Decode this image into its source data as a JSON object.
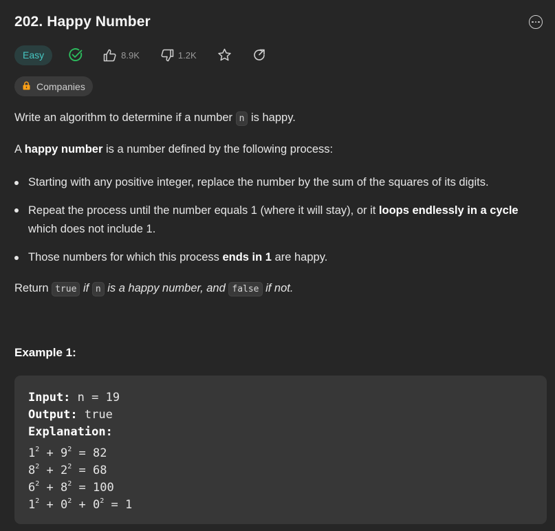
{
  "problem": {
    "title": "202. Happy Number",
    "difficulty": "Easy",
    "likes": "8.9K",
    "dislikes": "1.2K",
    "companies_label": "Companies"
  },
  "description": {
    "p1_a": "Write an algorithm to determine if a number ",
    "p1_code": "n",
    "p1_b": " is happy.",
    "p2_a": "A ",
    "p2_bold": "happy number",
    "p2_b": " is a number defined by the following process:",
    "bullet1": "Starting with any positive integer, replace the number by the sum of the squares of its digits.",
    "bullet2_a": "Repeat the process until the number equals 1 (where it will stay), or it ",
    "bullet2_bold": "loops endlessly in a cycle",
    "bullet2_b": " which does not include 1.",
    "bullet3_a": "Those numbers for which this process ",
    "bullet3_bold": "ends in 1",
    "bullet3_b": " are happy.",
    "ret_a": "Return ",
    "ret_code1": "true",
    "ret_b": " if ",
    "ret_code2": "n",
    "ret_c": " is a happy number, and ",
    "ret_code3": "false",
    "ret_d": " if not."
  },
  "example1": {
    "title": "Example 1:",
    "input_label": "Input:",
    "input_value": " n = 19",
    "output_label": "Output:",
    "output_value": " true",
    "explanation_label": "Explanation:",
    "lines": [
      {
        "a": "1",
        "b": "9",
        "rest": " = 82"
      },
      {
        "a": "8",
        "b": "2",
        "rest": " = 68"
      },
      {
        "a": "6",
        "b": "8",
        "rest": " = 100"
      }
    ],
    "last_line": {
      "a": "1",
      "b": "0",
      "c": "0",
      "rest": " = 1"
    },
    "exp": "2",
    "plus": " + "
  },
  "colors": {
    "easy": "#46c6c2",
    "solved": "#2cbb5d",
    "lock": "#ffa116"
  }
}
